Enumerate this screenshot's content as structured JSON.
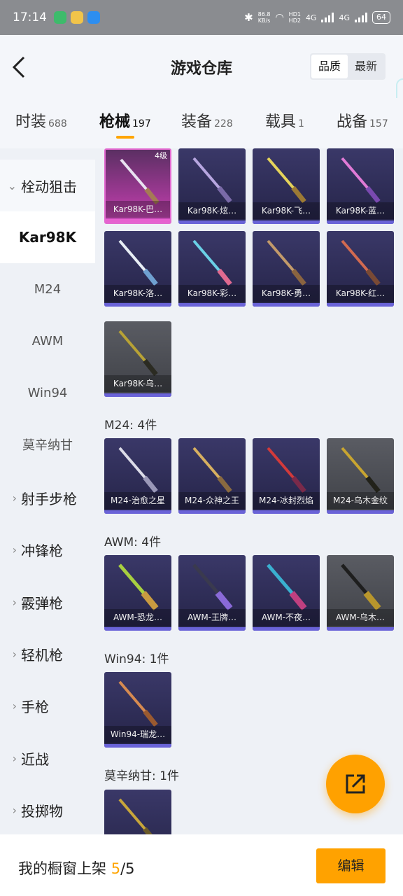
{
  "status_bar": {
    "time": "17:14",
    "net_speed": "86.8",
    "net_unit": "KB/s",
    "hd1": "HD1",
    "hd2": "HD2",
    "net1": "4G",
    "net2": "4G",
    "battery": "64"
  },
  "header": {
    "title": "游戏仓库",
    "sort": {
      "quality": "品质",
      "latest": "最新"
    }
  },
  "tabs": [
    {
      "label": "时装",
      "count": "688"
    },
    {
      "label": "枪械",
      "count": "197"
    },
    {
      "label": "装备",
      "count": "228"
    },
    {
      "label": "载具",
      "count": "1"
    },
    {
      "label": "战备",
      "count": "157"
    }
  ],
  "sidebar": {
    "group_open": "栓动狙击",
    "sub_selected": "Kar98K",
    "subs": [
      "M24",
      "AWM",
      "Win94",
      "莫辛纳甘"
    ],
    "groups": [
      "射手步枪",
      "冲锋枪",
      "霰弹枪",
      "轻机枪",
      "手枪",
      "近战",
      "投掷物"
    ]
  },
  "content": {
    "kar_level": "4级",
    "kar98k": [
      "Kar98K-巴…",
      "Kar98K-炫…",
      "Kar98K-飞…",
      "Kar98K-蓝…",
      "Kar98K-洛…",
      "Kar98K-彩…",
      "Kar98K-勇…",
      "Kar98K-红…",
      "Kar98K-乌…"
    ],
    "m24_header": "M24: 4件",
    "m24": [
      "M24-治愈之星",
      "M24-众神之王",
      "M24-冰封烈焰",
      "M24-乌木金纹"
    ],
    "awm_header": "AWM: 4件",
    "awm": [
      "AWM-恐龙…",
      "AWM-王牌…",
      "AWM-不夜…",
      "AWM-乌木…"
    ],
    "win94_header": "Win94: 1件",
    "win94": [
      "Win94-瑞龙…"
    ],
    "mosin_header": "莫辛纳甘: 1件"
  },
  "bottom": {
    "label": "我的橱窗上架 ",
    "count": "5",
    "total": "/5",
    "edit": "编辑"
  },
  "colors": {
    "accent": "#ffa500",
    "card_bg": "#2e2d58",
    "card_bar": "#6a63d8",
    "pink": "#c94bb8"
  }
}
